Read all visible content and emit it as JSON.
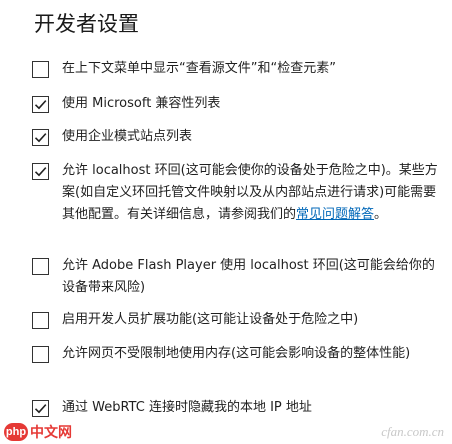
{
  "page": {
    "title": "开发者设置"
  },
  "options": [
    {
      "id": "view-source-inspect",
      "checked": false,
      "label": "在上下文菜单中显示“查看源文件”和“检查元素”"
    },
    {
      "id": "ms-compat-list",
      "checked": true,
      "label": "使用 Microsoft 兼容性列表"
    },
    {
      "id": "enterprise-mode-list",
      "checked": true,
      "label": "使用企业模式站点列表"
    },
    {
      "id": "allow-localhost",
      "checked": true,
      "label_pre": "允许 localhost 环回(这可能会使你的设备处于危险之中)。某些方案(如自定义环回托管文件映射以及从内部站点进行请求)可能需要其他配置。有关详细信息，请参阅我们的",
      "link": "常见问题解答",
      "label_post": "。"
    },
    {
      "id": "flash-localhost",
      "checked": false,
      "label": "允许 Adobe Flash Player 使用 localhost 环回(这可能会给你的设备带来风险)"
    },
    {
      "id": "dev-extensions",
      "checked": false,
      "label": "启用开发人员扩展功能(这可能让设备处于危险之中)"
    },
    {
      "id": "unrestricted-memory",
      "checked": false,
      "label": "允许网页不受限制地使用内存(这可能会影响设备的整体性能)"
    },
    {
      "id": "hide-ip-webrtc",
      "checked": true,
      "label": "通过 WebRTC 连接时隐藏我的本地 IP 地址"
    }
  ],
  "watermark": {
    "logo_text": "php",
    "site_text": "中文网",
    "right_text": "cfan.com.cn"
  }
}
